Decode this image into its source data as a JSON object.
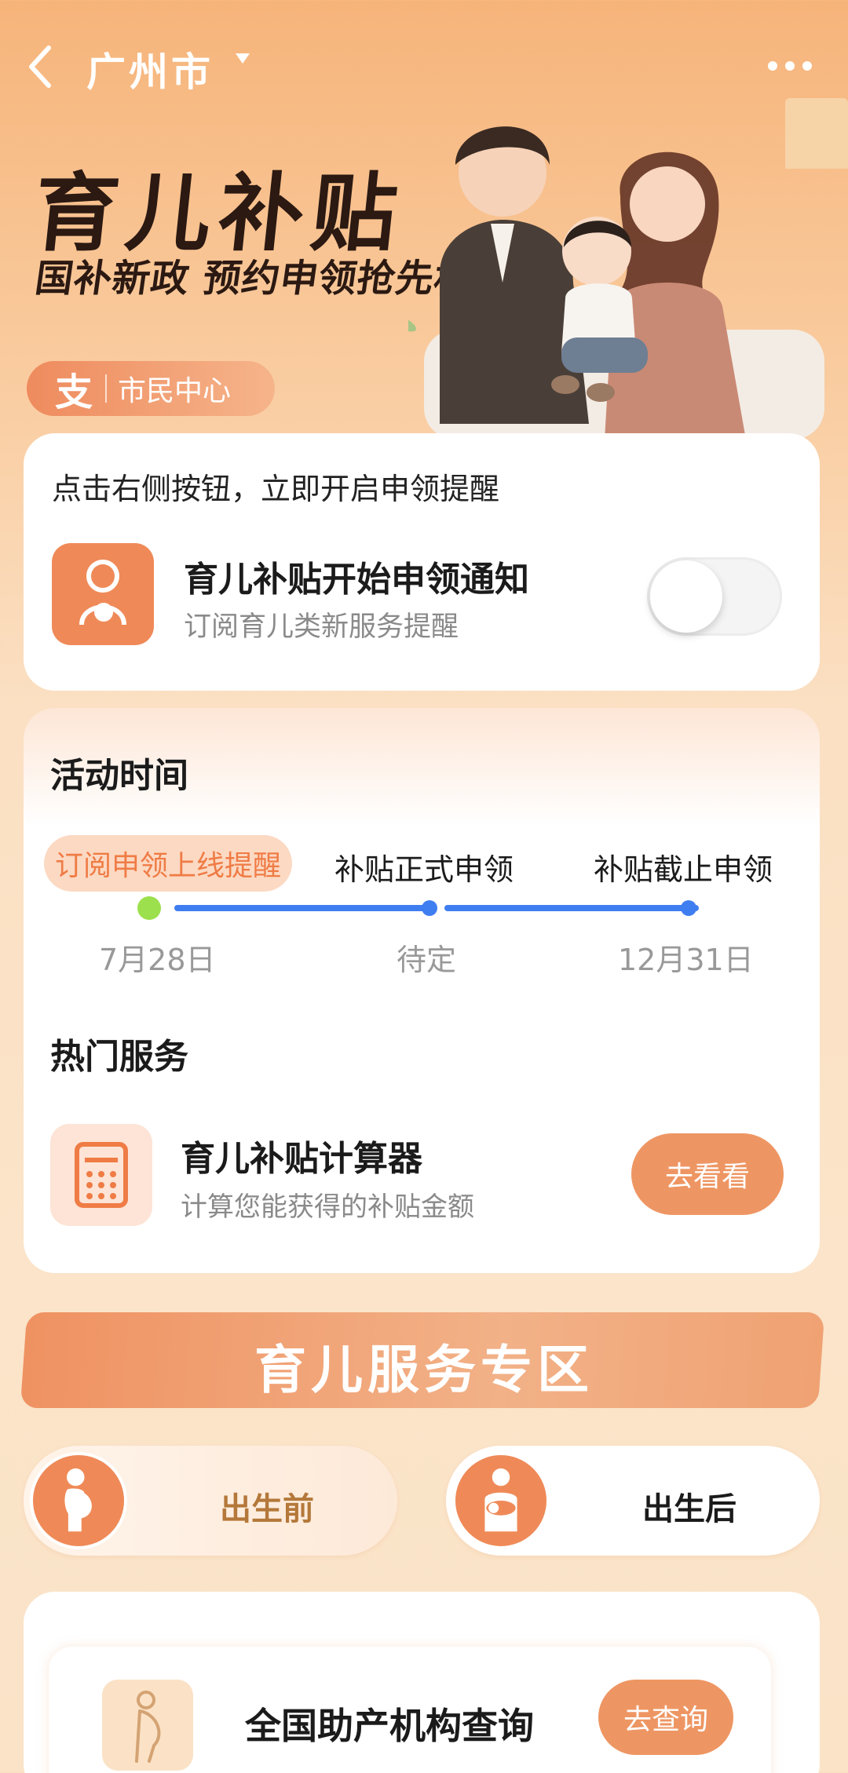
{
  "header": {
    "city": "广州市"
  },
  "hero": {
    "title": "育儿补贴",
    "subtitle": "国补新政 预约申领抢先机",
    "tag_logo": "支",
    "tag_label": "市民中心"
  },
  "remind": {
    "hint": "点击右侧按钮，立即开启申领提醒",
    "title": "育儿补贴开始申领通知",
    "desc": "订阅育儿类新服务提醒",
    "toggle_on": false
  },
  "schedule": {
    "title": "活动时间",
    "steps": [
      {
        "label": "订阅申领上线提醒",
        "date": "7月28日",
        "active": true
      },
      {
        "label": "补贴正式申领",
        "date": "待定",
        "active": false
      },
      {
        "label": "补贴截止申领",
        "date": "12月31日",
        "active": false
      }
    ]
  },
  "hot": {
    "title": "热门服务",
    "item_title": "育儿补贴计算器",
    "item_desc": "计算您能获得的补贴金额",
    "button": "去看看"
  },
  "zone": {
    "title": "育儿服务专区",
    "tabs": [
      {
        "label": "出生前",
        "selected": true
      },
      {
        "label": "出生后",
        "selected": false
      }
    ]
  },
  "org": {
    "title": "全国助产机构查询",
    "button": "去查询"
  },
  "colors": {
    "accent": "#ef8a58",
    "timeline": "#3f7ef0",
    "active_dot": "#9ce04d"
  }
}
